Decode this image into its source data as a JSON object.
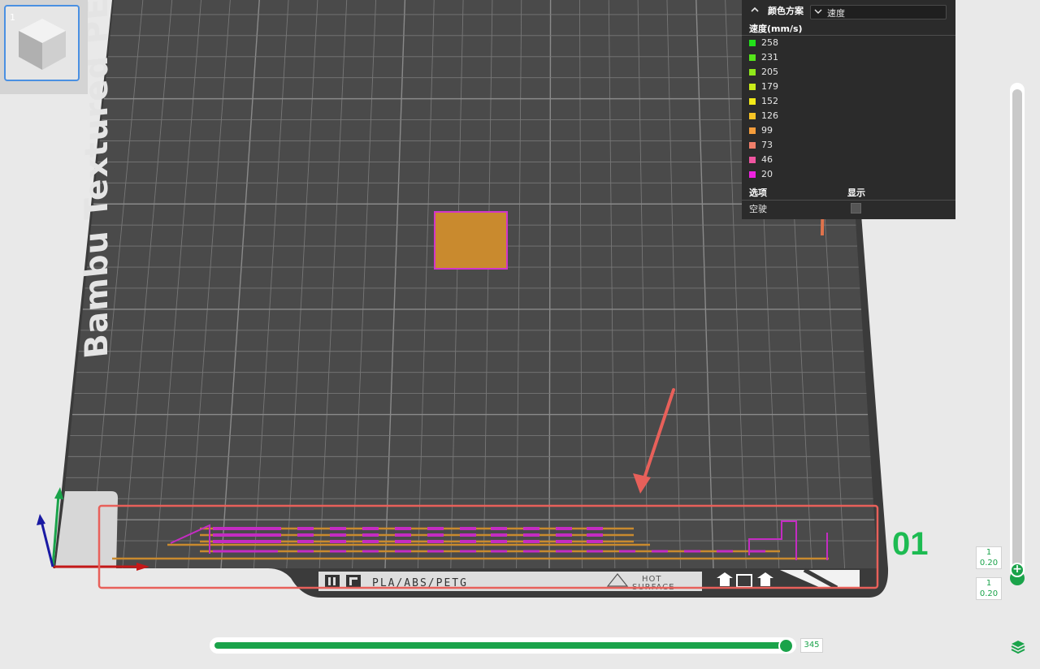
{
  "plate": {
    "name": "Bambu Textured PEI Plate",
    "label_materials": "PLA/ABS/PETG",
    "label_hot": "HOT",
    "label_surface": "SURFACE"
  },
  "thumbnail": {
    "index": "1"
  },
  "legend": {
    "title": "颜色方案",
    "scheme_value": "速度",
    "speed_title": "速度(mm/s)",
    "items": [
      {
        "label": "258",
        "color": "#22e11a"
      },
      {
        "label": "231",
        "color": "#55e51a"
      },
      {
        "label": "205",
        "color": "#8fe81a"
      },
      {
        "label": "179",
        "color": "#c9ec1a"
      },
      {
        "label": "152",
        "color": "#f3ea18"
      },
      {
        "label": "126",
        "color": "#f7c425"
      },
      {
        "label": "99",
        "color": "#f59d3b"
      },
      {
        "label": "73",
        "color": "#f07f6a"
      },
      {
        "label": "46",
        "color": "#ef55a0"
      },
      {
        "label": "20",
        "color": "#ee22e0"
      }
    ],
    "options_label": "选项",
    "show_label": "显示",
    "travel_label": "空驶"
  },
  "layer_slider": {
    "top_layer": "1",
    "top_height": "0.20",
    "bottom_layer": "1",
    "bottom_height": "0.20"
  },
  "move_slider": {
    "value": "345",
    "progress": 0.97
  },
  "annotation": {
    "number": "01",
    "color": "#1dbb52",
    "box_color": "#e8605a"
  },
  "colors": {
    "accent": "#1aa34a",
    "bed": "#4a4a4a",
    "grid": "#7a7a7a"
  }
}
